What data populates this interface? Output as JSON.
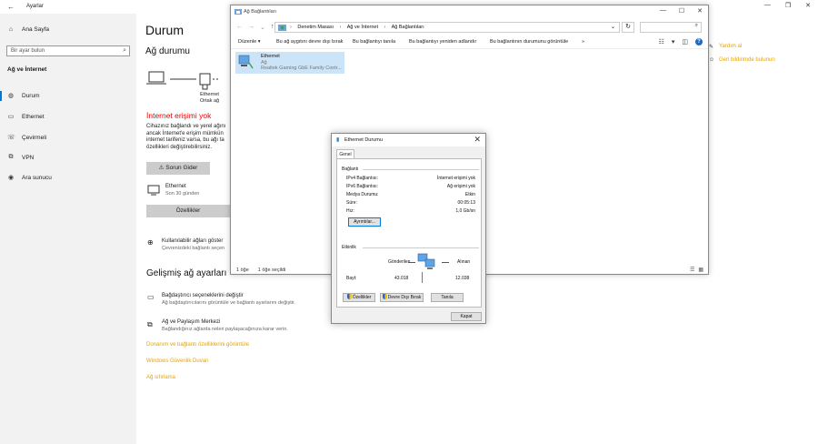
{
  "settings": {
    "title": "Ayarlar",
    "sidebar": {
      "home": "Ana Sayfa",
      "search_placeholder": "Bir ayar bulun",
      "section": "Ağ ve İnternet",
      "items": [
        "Durum",
        "Ethernet",
        "Çevirmeli",
        "VPN",
        "Ara sunucu"
      ]
    },
    "main": {
      "page_title": "Durum",
      "network_status_heading": "Ağ durumu",
      "diagram_label_1": "Ethernet",
      "diagram_label_2": "Ortak ağ",
      "no_internet": "İnternet erişimi yok",
      "desc_line1": "Cihazınız bağlandı ve yerel ağını",
      "desc_line2": "ancak İnternet'e erişim mümkün",
      "desc_line3": "internet tarifeniz varsa, bu ağı ta",
      "desc_line4": "özellikleri değiştirebilirsiniz.",
      "troubleshoot_button": "Sorun Gider",
      "ethernet_name": "Ethernet",
      "ethernet_time": "Son 30 günden",
      "properties_button": "Özellikler",
      "available_title": "Kullanılabilir ağları göster",
      "available_sub": "Çevrenizdeki bağlantı seçen",
      "advanced_heading": "Gelişmiş ağ ayarları",
      "adapter_title": "Bağdaştırıcı seçeneklerini değiştir",
      "adapter_sub": "Ağ bağdaştırıcılarını görüntüle ve bağlantı ayarlarını değiştir.",
      "sharing_title": "Ağ ve Paylaşım Merkezi",
      "sharing_sub": "Bağlandığınız ağlarda neleri paylaşacağınıza karar verin.",
      "link1": "Donanım ve bağlantı özelliklerini görüntüle",
      "link2": "Windows Güvenlik Duvarı",
      "link3": "Ağ sıfırlama",
      "help_link": "Yardım al",
      "feedback_link": "Geri bildirimde bulunun"
    }
  },
  "net_connections": {
    "title": "Ağ Bağlantıları",
    "path": [
      "Denetim Masası",
      "Ağ ve İnternet",
      "Ağ Bağlantıları"
    ],
    "toolbar": [
      "Düzenle ▾",
      "Bu ağ aygıtını devre dışı bırak",
      "Bu bağlantıyı tanıla",
      "Bu bağlantıyı yeniden adlandır",
      "Bu bağlantının durumunu görüntüle",
      "»"
    ],
    "adapter": {
      "name": "Ethernet",
      "network": "Ağ",
      "device": "Realtek Gaming GbE Family Contr..."
    },
    "status_count": "1 öğe",
    "status_selected": "1 öğe seçildi"
  },
  "ethernet_status": {
    "title": "Ethernet Durumu",
    "tab": "Genel",
    "connection_group": "Bağlantı",
    "rows": [
      {
        "label": "IPv4 Bağlantısı:",
        "value": "İnternet erişimi yok"
      },
      {
        "label": "IPv6 Bağlantısı:",
        "value": "Ağ erişimi yok"
      },
      {
        "label": "Medya Durumu:",
        "value": "Etkin"
      },
      {
        "label": "Süre:",
        "value": "00:05:13"
      },
      {
        "label": "Hız:",
        "value": "1,0 Gb/sn"
      }
    ],
    "details_button": "Ayrıntılar...",
    "activity_group": "Etkinlik",
    "sent_label": "Gönderilen",
    "received_label": "Alınan",
    "bytes_label": "Bayt:",
    "bytes_sent": "43.018",
    "bytes_received": "12.038",
    "properties_button": "Özellikler",
    "disable_button": "Devre Dışı Bırak",
    "diagnose_button": "Tanıla",
    "close_button": "Kapat"
  }
}
